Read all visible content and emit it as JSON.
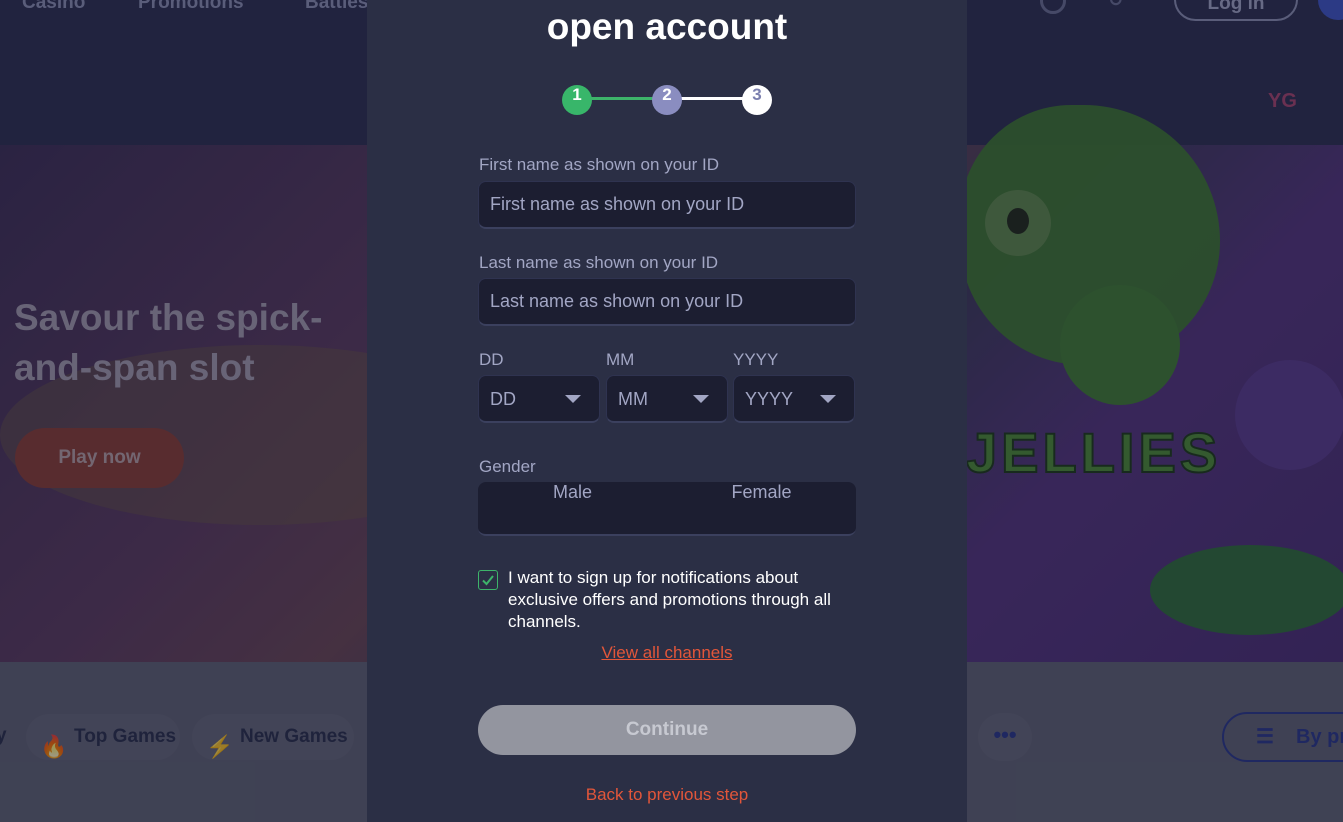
{
  "background": {
    "nav": {
      "items": [
        "Casino",
        "Promotions",
        "Battles"
      ],
      "login_label": "Log in"
    },
    "hero": {
      "heading": "Savour the spick-and-span slot",
      "play_label": "Play now",
      "game_logo_text": "JELLIES",
      "provider_text": "YG"
    },
    "categories": {
      "partial_left": "y",
      "items": [
        {
          "label": "Top Games",
          "icon": "flame-icon"
        },
        {
          "label": "New Games",
          "icon": "lightning-icon"
        }
      ],
      "more_label": "•••",
      "filter_label": "By pr",
      "filter_icon": "sliders-icon"
    }
  },
  "modal": {
    "title": "open account",
    "stepper": {
      "steps": [
        "1",
        "2",
        "3"
      ],
      "current_step": 2,
      "colors": {
        "done": "#38b66a",
        "current": "#8a8dc0",
        "upcoming": "#ffffff"
      }
    },
    "first_name": {
      "label": "First name as shown on your ID",
      "placeholder": "First name as shown on your ID"
    },
    "last_name": {
      "label": "Last name as shown on your ID",
      "placeholder": "Last name as shown on your ID"
    },
    "dob": {
      "day_label": "DD",
      "day_value": "DD",
      "month_label": "MM",
      "month_value": "MM",
      "year_label": "YYYY",
      "year_value": "YYYY"
    },
    "gender": {
      "label": "Gender",
      "options": [
        "Male",
        "Female"
      ]
    },
    "consent": {
      "checked": true,
      "text": "I want to sign up for notifications about exclusive offers and promotions through all channels."
    },
    "view_channels_label": "View all channels",
    "continue_label": "Continue",
    "back_label": "Back to previous step",
    "colors": {
      "accent_link": "#e2563a",
      "panel": "#2b2f45",
      "input_bg": "#1c1e31",
      "success": "#3db46a"
    }
  }
}
